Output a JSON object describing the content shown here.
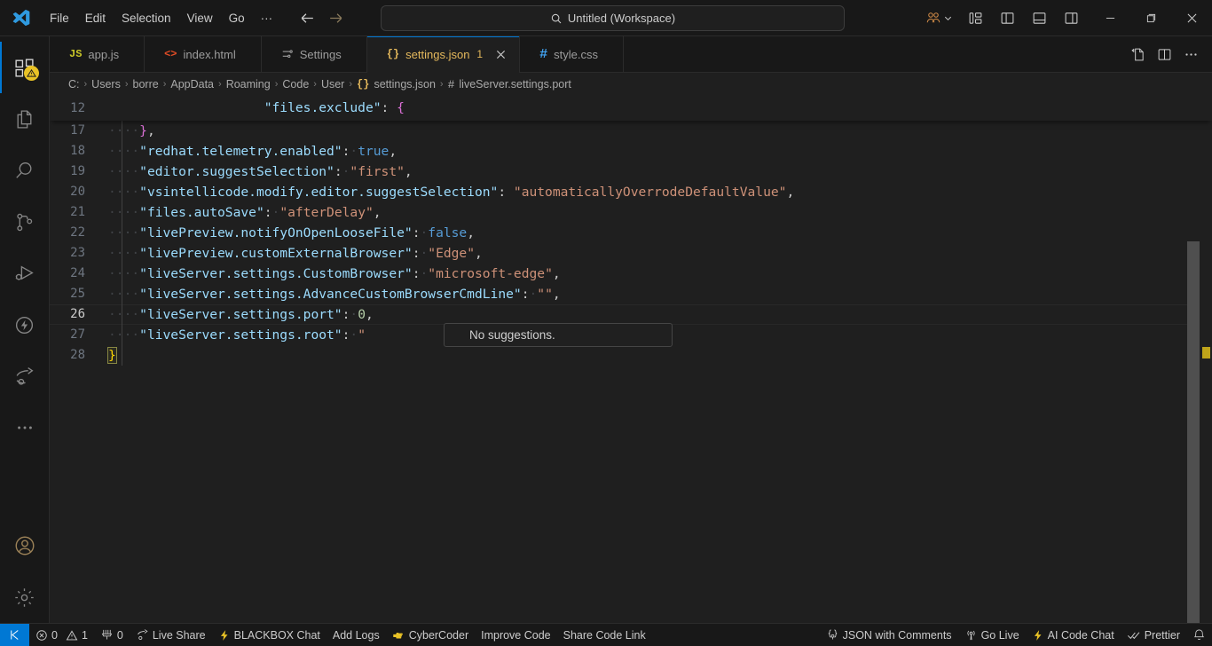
{
  "titlebar": {
    "logo_icon": "vscode-logo-icon",
    "menu": [
      {
        "label": "File",
        "name": "menu-file"
      },
      {
        "label": "Edit",
        "name": "menu-edit"
      },
      {
        "label": "Selection",
        "name": "menu-selection"
      },
      {
        "label": "View",
        "name": "menu-view"
      },
      {
        "label": "Go",
        "name": "menu-go"
      },
      {
        "label": "···",
        "name": "menu-more"
      }
    ],
    "nav": {
      "back_icon": "arrow-left-icon",
      "forward_icon": "arrow-right-icon"
    },
    "command_center": {
      "search_icon": "search-icon",
      "text": "Untitled (Workspace)",
      "placeholder": "Search"
    },
    "accounts": {
      "icon": "accounts-icon",
      "chevron": "chevron-down-icon"
    },
    "layout_buttons": [
      {
        "name": "customize-layout-button",
        "icon": "layout-customize-icon"
      },
      {
        "name": "toggle-primary-sidebar-button",
        "icon": "layout-sidebar-left-icon"
      },
      {
        "name": "toggle-panel-button",
        "icon": "layout-panel-icon"
      },
      {
        "name": "toggle-secondary-sidebar-button",
        "icon": "layout-sidebar-right-icon"
      }
    ],
    "window_controls": [
      {
        "name": "minimize-button",
        "glyph": "─"
      },
      {
        "name": "maximize-button",
        "glyph": "❐"
      },
      {
        "name": "close-button",
        "glyph": "✕"
      }
    ]
  },
  "activitybar": {
    "items": [
      {
        "name": "activitybar-explorer",
        "icon": "files-explorer-icon",
        "active": true,
        "badge": "⚠"
      },
      {
        "name": "activitybar-open-editors",
        "icon": "copy-files-icon",
        "active": false
      },
      {
        "name": "activitybar-search",
        "icon": "search-icon",
        "active": false
      },
      {
        "name": "activitybar-source-control",
        "icon": "source-control-icon",
        "active": false
      },
      {
        "name": "activitybar-run-debug",
        "icon": "run-and-debug-icon",
        "active": false
      },
      {
        "name": "activitybar-extensions",
        "icon": "lightning-circle-icon",
        "active": false
      },
      {
        "name": "activitybar-live-share",
        "icon": "live-share-icon",
        "active": false
      },
      {
        "name": "activitybar-more",
        "icon": "ellipsis-icon",
        "active": false
      }
    ],
    "bottom": [
      {
        "name": "activitybar-accounts",
        "icon": "account-icon"
      },
      {
        "name": "activitybar-settings",
        "icon": "gear-icon"
      }
    ]
  },
  "tabs": [
    {
      "name": "tab-app-js",
      "label": "app.js",
      "icon": "js-file-icon",
      "icon_glyph": "JS",
      "icon_color": "#c9c628",
      "active": false,
      "dirty": "",
      "closeable": false
    },
    {
      "name": "tab-index-html",
      "label": "index.html",
      "icon": "html-file-icon",
      "icon_glyph": "<>",
      "icon_color": "#e44d26",
      "active": false,
      "dirty": "",
      "closeable": false
    },
    {
      "name": "tab-settings",
      "label": "Settings",
      "icon": "settings-editor-icon",
      "icon_glyph": "⩏",
      "icon_color": "#9d9d9d",
      "active": false,
      "dirty": "",
      "closeable": false
    },
    {
      "name": "tab-settings-json",
      "label": "settings.json",
      "icon": "json-file-icon",
      "icon_glyph": "{}",
      "icon_color": "#e5b95c",
      "active": true,
      "dirty": "1",
      "closeable": true
    },
    {
      "name": "tab-style-css",
      "label": "style.css",
      "icon": "css-file-icon",
      "icon_glyph": "#",
      "icon_color": "#42a5f5",
      "active": false,
      "dirty": "",
      "closeable": false
    }
  ],
  "editor_actions": [
    {
      "name": "open-changes-button",
      "icon": "open-changes-icon"
    },
    {
      "name": "split-editor-button",
      "icon": "split-editor-icon"
    },
    {
      "name": "more-actions-button",
      "icon": "ellipsis-icon"
    }
  ],
  "breadcrumbs": [
    {
      "label": "C:",
      "icon": ""
    },
    {
      "label": "Users",
      "icon": ""
    },
    {
      "label": "borre",
      "icon": ""
    },
    {
      "label": "AppData",
      "icon": ""
    },
    {
      "label": "Roaming",
      "icon": ""
    },
    {
      "label": "Code",
      "icon": ""
    },
    {
      "label": "User",
      "icon": ""
    },
    {
      "label": "settings.json",
      "icon": "json-file-icon"
    },
    {
      "label": "liveServer.settings.port",
      "icon": "symbol-key-icon"
    }
  ],
  "breadcrumb_separator": "›",
  "sticky_line": {
    "number": "12",
    "indent": "        ",
    "prop": "\"files.exclude\"",
    "colon": ": ",
    "brace": "{"
  },
  "code_lines": [
    {
      "number": "17",
      "current": false,
      "dots": "····",
      "parts": [
        {
          "t": "}",
          "c": "k-brace-pink"
        },
        {
          "t": ",",
          "c": "k-punc"
        }
      ]
    },
    {
      "number": "18",
      "current": false,
      "dots": "····",
      "parts": [
        {
          "t": "\"redhat.telemetry.enabled\"",
          "c": "k-prop"
        },
        {
          "t": ":",
          "c": "k-punc"
        },
        {
          "t": "·",
          "c": "dots"
        },
        {
          "t": "true",
          "c": "k-bool"
        },
        {
          "t": ",",
          "c": "k-punc"
        }
      ]
    },
    {
      "number": "19",
      "current": false,
      "dots": "····",
      "parts": [
        {
          "t": "\"editor.suggestSelection\"",
          "c": "k-prop"
        },
        {
          "t": ":",
          "c": "k-punc"
        },
        {
          "t": "·",
          "c": "dots"
        },
        {
          "t": "\"first\"",
          "c": "k-str"
        },
        {
          "t": ",",
          "c": "k-punc"
        }
      ]
    },
    {
      "number": "20",
      "current": false,
      "dots": "····",
      "parts": [
        {
          "t": "\"vsintellicode.modify.editor.suggestSelection\"",
          "c": "k-prop"
        },
        {
          "t": ": ",
          "c": "k-punc"
        },
        {
          "t": "\"automaticallyOverrodeDefaultValue\"",
          "c": "k-str"
        },
        {
          "t": ",",
          "c": "k-punc"
        }
      ]
    },
    {
      "number": "21",
      "current": false,
      "dots": "····",
      "parts": [
        {
          "t": "\"files.autoSave\"",
          "c": "k-prop"
        },
        {
          "t": ":",
          "c": "k-punc"
        },
        {
          "t": "·",
          "c": "dots"
        },
        {
          "t": "\"afterDelay\"",
          "c": "k-str"
        },
        {
          "t": ",",
          "c": "k-punc"
        }
      ]
    },
    {
      "number": "22",
      "current": false,
      "dots": "····",
      "parts": [
        {
          "t": "\"livePreview.notifyOnOpenLooseFile\"",
          "c": "k-prop"
        },
        {
          "t": ":",
          "c": "k-punc"
        },
        {
          "t": "·",
          "c": "dots"
        },
        {
          "t": "false",
          "c": "k-bool"
        },
        {
          "t": ",",
          "c": "k-punc"
        }
      ]
    },
    {
      "number": "23",
      "current": false,
      "dots": "····",
      "parts": [
        {
          "t": "\"livePreview.customExternalBrowser\"",
          "c": "k-prop"
        },
        {
          "t": ":",
          "c": "k-punc"
        },
        {
          "t": "·",
          "c": "dots"
        },
        {
          "t": "\"Edge\"",
          "c": "k-str"
        },
        {
          "t": ",",
          "c": "k-punc"
        }
      ]
    },
    {
      "number": "24",
      "current": false,
      "dots": "····",
      "parts": [
        {
          "t": "\"liveServer.settings.CustomBrowser\"",
          "c": "k-prop"
        },
        {
          "t": ":",
          "c": "k-punc"
        },
        {
          "t": "·",
          "c": "dots"
        },
        {
          "t": "\"microsoft-edge\"",
          "c": "k-str"
        },
        {
          "t": ",",
          "c": "k-punc"
        }
      ]
    },
    {
      "number": "25",
      "current": false,
      "dots": "····",
      "parts": [
        {
          "t": "\"liveServer.settings.AdvanceCustomBrowserCmdLine\"",
          "c": "k-prop"
        },
        {
          "t": ":",
          "c": "k-punc"
        },
        {
          "t": "·",
          "c": "dots"
        },
        {
          "t": "\"\"",
          "c": "k-str"
        },
        {
          "t": ",",
          "c": "k-punc"
        }
      ]
    },
    {
      "number": "26",
      "current": true,
      "dots": "····",
      "parts": [
        {
          "t": "\"liveServer.settings.port\"",
          "c": "k-prop"
        },
        {
          "t": ":",
          "c": "k-punc"
        },
        {
          "t": "·",
          "c": "dots"
        },
        {
          "t": "0",
          "c": "k-num"
        },
        {
          "t": ",",
          "c": "k-punc"
        }
      ]
    },
    {
      "number": "27",
      "current": false,
      "dots": "····",
      "parts": [
        {
          "t": "\"liveServer.settings.root\"",
          "c": "k-prop"
        },
        {
          "t": ":",
          "c": "k-punc"
        },
        {
          "t": "·",
          "c": "dots"
        },
        {
          "t": "\"",
          "c": "k-str"
        }
      ]
    },
    {
      "number": "28",
      "current": false,
      "dots": "",
      "parts": [
        {
          "t": "}",
          "c": "k-brace-yellow brace-match"
        }
      ]
    }
  ],
  "suggest_widget": {
    "name": "suggest-widget",
    "message": "No suggestions."
  },
  "statusbar": {
    "remote": {
      "name": "remote-indicator",
      "icon": "remote-icon"
    },
    "left": [
      {
        "name": "status-problems",
        "icon": "error-warning-icon",
        "label": "0",
        "label2": "1"
      },
      {
        "name": "status-ports",
        "icon": "ports-icon",
        "label": "0"
      },
      {
        "name": "status-live-share",
        "icon": "live-share-icon",
        "label": "Live Share"
      },
      {
        "name": "status-blackbox-chat",
        "icon": "lightning-icon",
        "label": "BLACKBOX Chat"
      },
      {
        "name": "status-add-logs",
        "icon": "",
        "label": "Add Logs"
      },
      {
        "name": "status-cybercoder",
        "icon": "pointer-icon",
        "label": "CyberCoder"
      },
      {
        "name": "status-improve-code",
        "icon": "",
        "label": "Improve Code"
      },
      {
        "name": "status-share-code-link",
        "icon": "",
        "label": "Share Code Link"
      }
    ],
    "right": [
      {
        "name": "status-language-mode",
        "icon": "json-comments-icon",
        "label": "JSON with Comments"
      },
      {
        "name": "status-go-live",
        "icon": "broadcast-icon",
        "label": "Go Live"
      },
      {
        "name": "status-ai-code-chat",
        "icon": "lightning-icon",
        "label": "AI Code Chat"
      },
      {
        "name": "status-prettier",
        "icon": "check-check-icon",
        "label": "Prettier"
      },
      {
        "name": "status-notifications",
        "icon": "bell-icon",
        "label": ""
      }
    ]
  },
  "colors": {
    "accent": "#0078d4",
    "titlebar_bg": "#181818",
    "editor_bg": "#1f1f1f",
    "tab_active_fg": "#e5b95c",
    "warning": "#e8c226",
    "property": "#9cdcfe",
    "string": "#ce9178",
    "number": "#b5cea8",
    "boolean": "#569cd6"
  }
}
